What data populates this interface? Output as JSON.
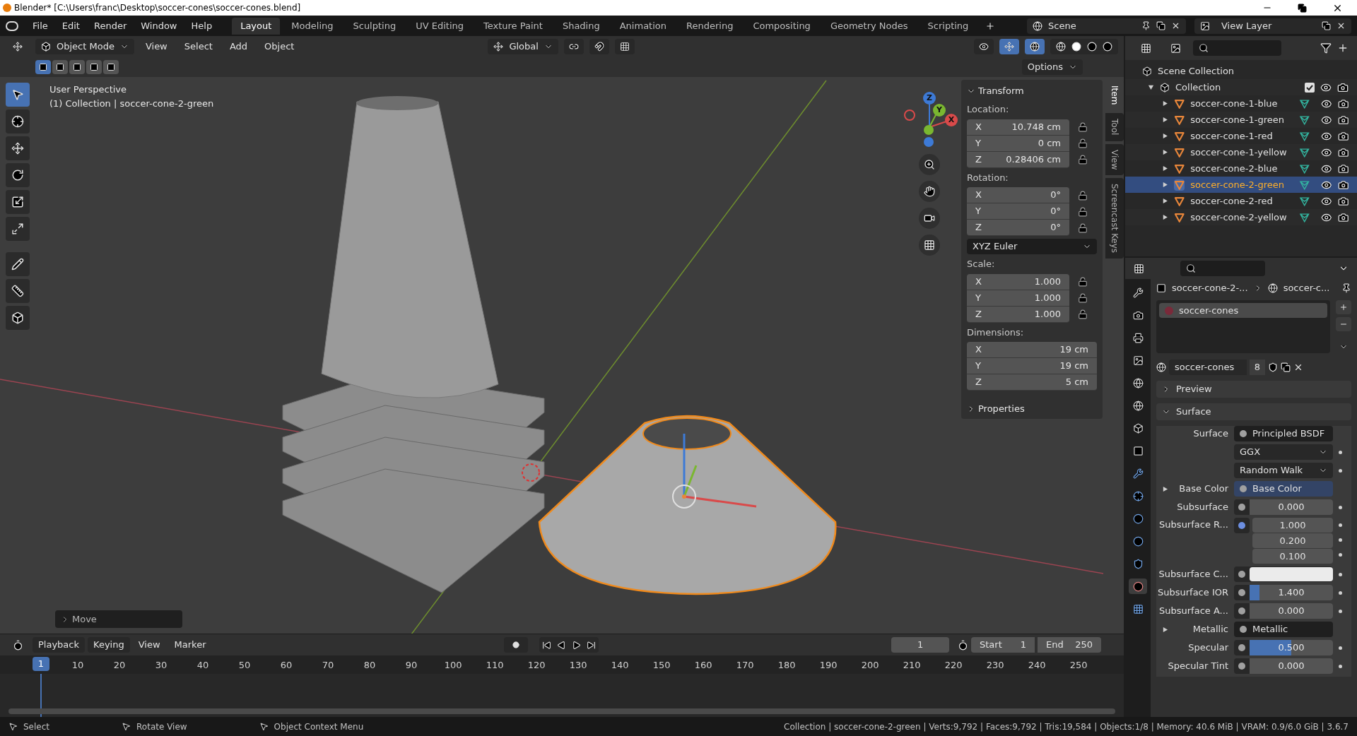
{
  "title_bar": {
    "title": "Blender* [C:\\Users\\franc\\Desktop\\soccer-cones\\soccer-cones.blend]"
  },
  "menu": [
    "File",
    "Edit",
    "Render",
    "Window",
    "Help"
  ],
  "workspaces": [
    {
      "label": "Layout",
      "selected": true
    },
    {
      "label": "Modeling",
      "selected": false
    },
    {
      "label": "Sculpting",
      "selected": false
    },
    {
      "label": "UV Editing",
      "selected": false
    },
    {
      "label": "Texture Paint",
      "selected": false
    },
    {
      "label": "Shading",
      "selected": false
    },
    {
      "label": "Animation",
      "selected": false
    },
    {
      "label": "Rendering",
      "selected": false
    },
    {
      "label": "Compositing",
      "selected": false
    },
    {
      "label": "Geometry Nodes",
      "selected": false
    },
    {
      "label": "Scripting",
      "selected": false
    }
  ],
  "scene": "Scene",
  "view_layer": "View Layer",
  "viewport_header": {
    "mode": "Object Mode",
    "menus": [
      "View",
      "Select",
      "Add",
      "Object"
    ],
    "orientation": "Global",
    "options": "Options"
  },
  "viewport": {
    "perspective": "User Perspective",
    "context": "(1) Collection | soccer-cone-2-green",
    "gizmo": [
      "Z",
      "Y",
      "X"
    ],
    "operator_panel": "Move"
  },
  "n_panel": {
    "tabs": [
      {
        "label": "Item",
        "selected": true
      },
      {
        "label": "Tool",
        "selected": false
      },
      {
        "label": "View",
        "selected": false
      },
      {
        "label": "Screencast Keys",
        "selected": false
      }
    ],
    "title": "Transform",
    "groups": [
      {
        "label": "Location:",
        "rows": [
          {
            "axis": "X",
            "value": "10.748 cm"
          },
          {
            "axis": "Y",
            "value": "0 cm"
          },
          {
            "axis": "Z",
            "value": "0.28406 cm"
          }
        ]
      },
      {
        "label": "Rotation:",
        "rows": [
          {
            "axis": "X",
            "value": "0°"
          },
          {
            "axis": "Y",
            "value": "0°"
          },
          {
            "axis": "Z",
            "value": "0°"
          }
        ],
        "mode": "XYZ Euler"
      },
      {
        "label": "Scale:",
        "rows": [
          {
            "axis": "X",
            "value": "1.000"
          },
          {
            "axis": "Y",
            "value": "1.000"
          },
          {
            "axis": "Z",
            "value": "1.000"
          }
        ]
      },
      {
        "label": "Dimensions:",
        "rows": [
          {
            "axis": "X",
            "value": "19 cm"
          },
          {
            "axis": "Y",
            "value": "19 cm"
          },
          {
            "axis": "Z",
            "value": "5 cm"
          }
        ]
      }
    ],
    "properties": "Properties"
  },
  "outliner": {
    "root": "Scene Collection",
    "collection": {
      "label": "Collection",
      "checked": true,
      "expanded": true,
      "children": [
        {
          "label": "soccer-cone-1-blue",
          "selected": false
        },
        {
          "label": "soccer-cone-1-green",
          "selected": false
        },
        {
          "label": "soccer-cone-1-red",
          "selected": false
        },
        {
          "label": "soccer-cone-1-yellow",
          "selected": false
        },
        {
          "label": "soccer-cone-2-blue",
          "selected": false
        },
        {
          "label": "soccer-cone-2-green",
          "selected": true
        },
        {
          "label": "soccer-cone-2-red",
          "selected": false
        },
        {
          "label": "soccer-cone-2-yellow",
          "selected": false
        }
      ]
    }
  },
  "properties": {
    "tabs": [
      {
        "selected": false
      },
      {
        "selected": false
      },
      {
        "selected": false
      },
      {
        "selected": false
      },
      {
        "selected": false
      },
      {
        "selected": false
      },
      {
        "selected": false
      },
      {
        "selected": false
      },
      {
        "selected": false
      },
      {
        "selected": false
      },
      {
        "selected": false
      },
      {
        "selected": false
      },
      {
        "selected": false
      },
      {
        "selected": true
      },
      {
        "selected": false
      }
    ],
    "breadcrumb": [
      "soccer-cone-2-...",
      "soccer-c..."
    ],
    "slots": [
      {
        "label": "soccer-cones",
        "selected": true
      }
    ],
    "material": {
      "name": "soccer-cones",
      "users": "8"
    },
    "panels": [
      {
        "label": "Preview",
        "expanded": false
      },
      {
        "label": "Surface",
        "expanded": true
      }
    ],
    "rows": [
      {
        "kind": "link",
        "label": "Surface",
        "value": "Principled BSDF"
      },
      {
        "kind": "dropdown",
        "value": "GGX"
      },
      {
        "kind": "dropdown",
        "value": "Random Walk"
      },
      {
        "kind": "link",
        "label": "Base Color",
        "value": "Base Color",
        "expandable": true
      },
      {
        "kind": "slider",
        "label": "Subsurface",
        "value": "0.000",
        "level": 0
      },
      {
        "kind": "vector",
        "label": "Subsurface R...",
        "values": [
          "1.000",
          "0.200",
          "0.100"
        ]
      },
      {
        "kind": "color",
        "label": "Subsurface C...",
        "color": "#ebebeb"
      },
      {
        "kind": "slider",
        "label": "Subsurface IOR",
        "value": "1.400",
        "level": 0.12
      },
      {
        "kind": "slider",
        "label": "Subsurface A...",
        "value": "0.000",
        "level": 0
      },
      {
        "kind": "link",
        "label": "Metallic",
        "value": "Metallic",
        "expandable": true
      },
      {
        "kind": "slider",
        "label": "Specular",
        "value": "0.500",
        "level": 0.5
      },
      {
        "kind": "slider",
        "label": "Specular Tint",
        "value": "0.000",
        "level": 0
      }
    ]
  },
  "timeline": {
    "menus": [
      "Playback",
      "Keying",
      "View",
      "Marker"
    ],
    "playhead": "1",
    "current_frame": "1",
    "start_label": "Start",
    "start": "1",
    "end_label": "End",
    "end": "250",
    "ticks": [
      "10",
      "20",
      "30",
      "40",
      "50",
      "60",
      "70",
      "80",
      "90",
      "100",
      "110",
      "120",
      "130",
      "140",
      "150",
      "160",
      "170",
      "180",
      "190",
      "200",
      "210",
      "220",
      "230",
      "240",
      "250"
    ]
  },
  "status_bar": {
    "hints": [
      "Select",
      "Rotate View",
      "Object Context Menu"
    ],
    "stats": "Collection | soccer-cone-2-green | Verts:9,792 | Faces:9,792 | Tris:19,584 | Objects:1/8 | Memory: 40.6 MiB | VRAM: 0.9/6.0 GiB | 3.6.7"
  }
}
